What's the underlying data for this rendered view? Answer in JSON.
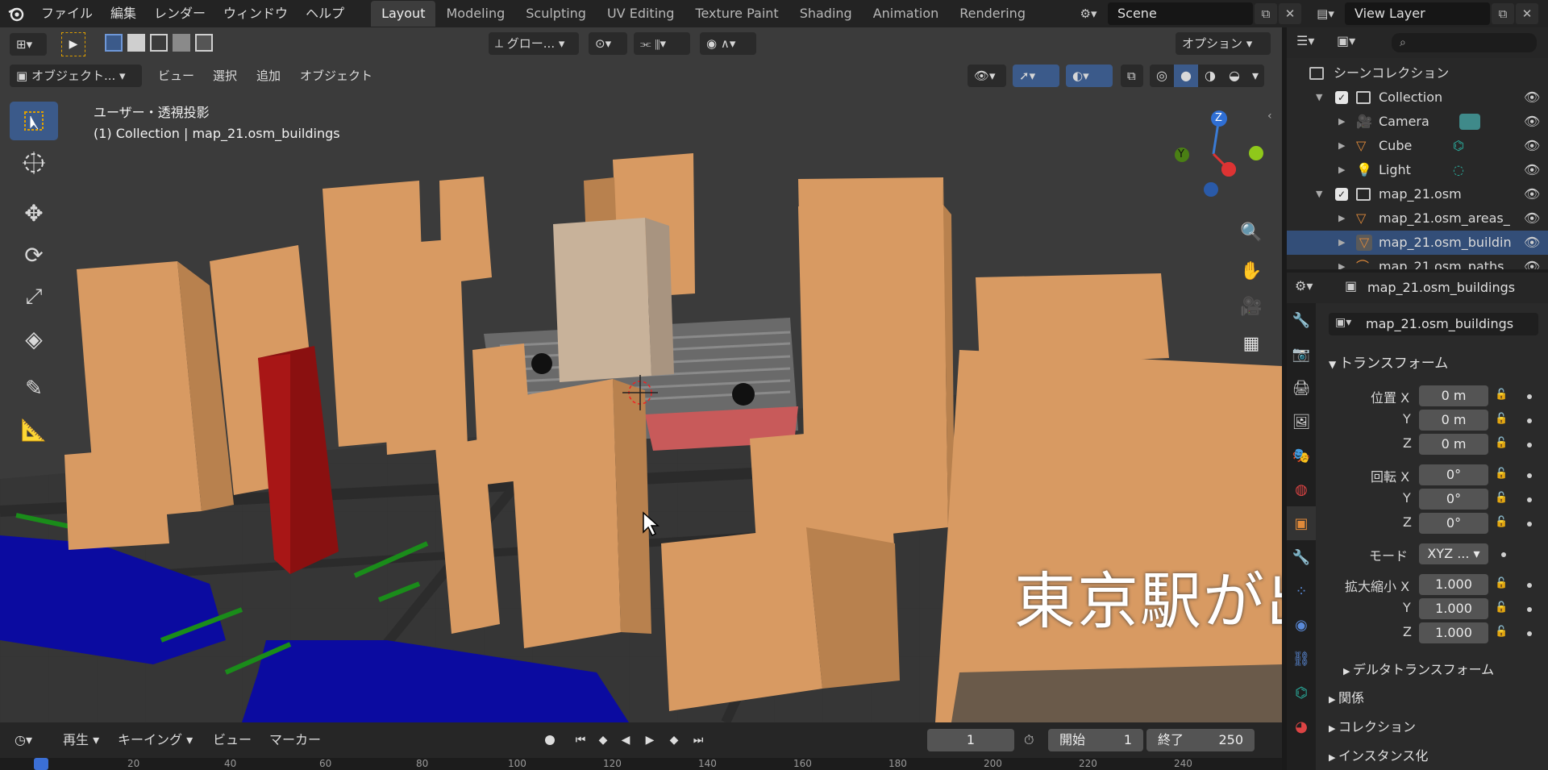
{
  "topbar": {
    "menus": [
      "ファイル",
      "編集",
      "レンダー",
      "ウィンドウ",
      "ヘルプ"
    ],
    "workspaces": [
      "Layout",
      "Modeling",
      "Sculpting",
      "UV Editing",
      "Texture Paint",
      "Shading",
      "Animation",
      "Rendering"
    ],
    "active_workspace": "Layout",
    "scene": "Scene",
    "view_layer": "View Layer"
  },
  "viewport": {
    "transform_orientation": "グロー...",
    "options_label": "オプション",
    "mode_label": "オブジェクト...",
    "menus": [
      "ビュー",
      "選択",
      "追加",
      "オブジェクト"
    ],
    "view_name": "ユーザー・透視投影",
    "collection_info": "(1) Collection | map_21.osm_buildings",
    "gizmo_axes": {
      "z": "Z",
      "x": "X",
      "y": "Y"
    },
    "subtitle": "東京駅が出現します"
  },
  "outliner": {
    "scene_collection": "シーンコレクション",
    "rows": [
      {
        "label": "Collection",
        "icon": "collection-icon"
      },
      {
        "label": "Camera",
        "icon": "camera-icon"
      },
      {
        "label": "Cube",
        "icon": "mesh-icon"
      },
      {
        "label": "Light",
        "icon": "light-icon"
      },
      {
        "label": "map_21.osm",
        "icon": "collection-icon"
      },
      {
        "label": "map_21.osm_areas_",
        "icon": "mesh-icon"
      },
      {
        "label": "map_21.osm_buildin",
        "icon": "mesh-icon"
      },
      {
        "label": "map_21.osm_paths",
        "icon": "curve-icon"
      }
    ]
  },
  "properties": {
    "object_name": "map_21.osm_buildings",
    "data_name": "map_21.osm_buildings",
    "transform_header": "トランスフォーム",
    "location_label": "位置 X",
    "location": [
      "0 m",
      "0 m",
      "0 m"
    ],
    "rotation_label": "回転 X",
    "rotation": [
      "0°",
      "0°",
      "0°"
    ],
    "mode_label": "モード",
    "mode_value": "XYZ ...",
    "scale_label": "拡大縮小 X",
    "scale": [
      "1.000",
      "1.000",
      "1.000"
    ],
    "axis_y": "Y",
    "axis_z": "Z",
    "delta_transform": "デルタトランスフォーム",
    "relations": "関係",
    "collections": "コレクション",
    "instancing": "インスタンス化"
  },
  "timeline": {
    "menus": [
      "再生",
      "キーイング",
      "ビュー",
      "マーカー"
    ],
    "current_frame": "1",
    "start_label": "開始",
    "start": "1",
    "end_label": "終了",
    "end": "250",
    "ruler_ticks": [
      "20",
      "40",
      "60",
      "80",
      "100",
      "120",
      "140",
      "160",
      "180",
      "200",
      "220",
      "240"
    ]
  },
  "colors": {
    "building": "#d89a62",
    "building_side": "#b8814e",
    "water": "#0a0a9e",
    "green_strip": "#1a8a1a",
    "red_building": "#8a1010",
    "accent_blue": "#3b5a8a"
  }
}
